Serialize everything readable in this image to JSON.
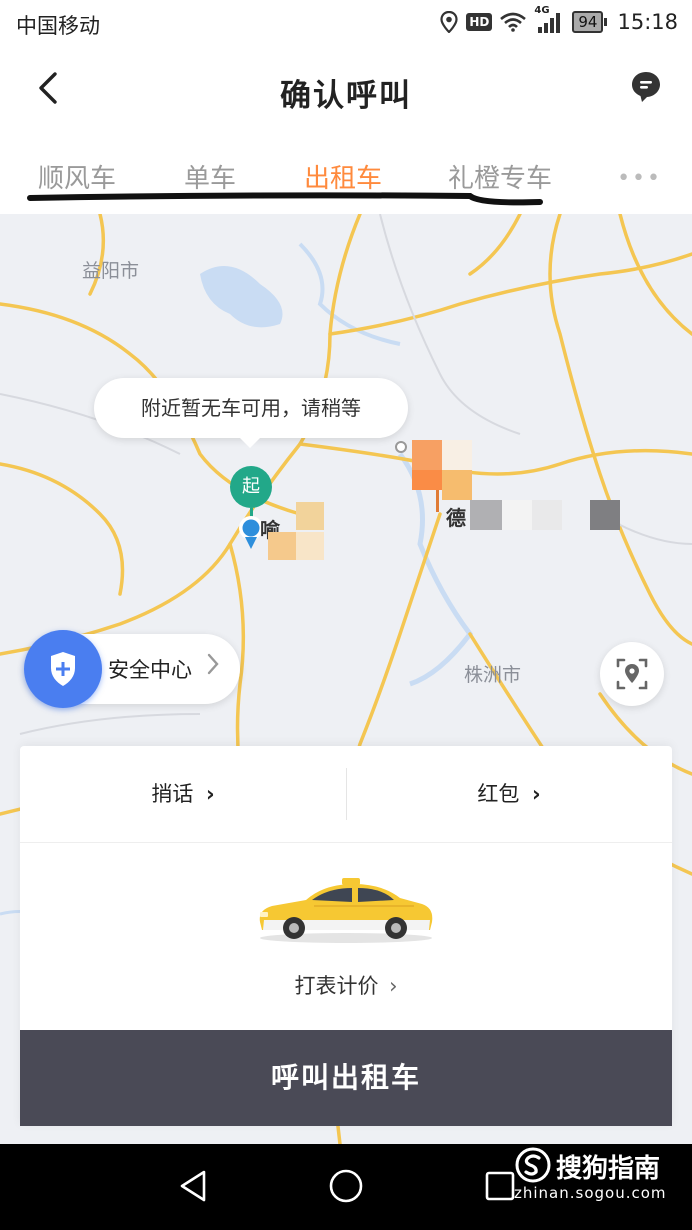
{
  "status_bar": {
    "carrier": "中国移动",
    "hd": "HD",
    "network": "4G",
    "battery": "94",
    "time": "15:18"
  },
  "header": {
    "title": "确认呼叫",
    "back_icon": "back-chevron-icon",
    "message_icon": "message-bubble-icon"
  },
  "tabs": [
    {
      "label": "顺风车",
      "active": false
    },
    {
      "label": "单车",
      "active": false
    },
    {
      "label": "出租车",
      "active": true
    },
    {
      "label": "礼橙专车",
      "active": false
    }
  ],
  "map": {
    "cities": [
      "益阳市",
      "株洲市"
    ],
    "bubble_text": "附近暂无车可用，请稍等",
    "start_marker": "起",
    "start_label": "喻",
    "dest_label": "德",
    "safety_center": "安全中心",
    "locate_icon": "locate-icon"
  },
  "card": {
    "message_option": "捎话",
    "red_packet_option": "红包",
    "chevron": "›",
    "car_image": "taxi-icon",
    "fare_type": "打表计价",
    "call_button": "呼叫出租车"
  },
  "watermark": {
    "name": "搜狗指南",
    "url": "zhinan.sogou.com"
  },
  "colors": {
    "accent": "#ff8a3d",
    "call_button": "#4a4a56",
    "start_pin": "#22a889",
    "safety": "#4a7ef0"
  }
}
